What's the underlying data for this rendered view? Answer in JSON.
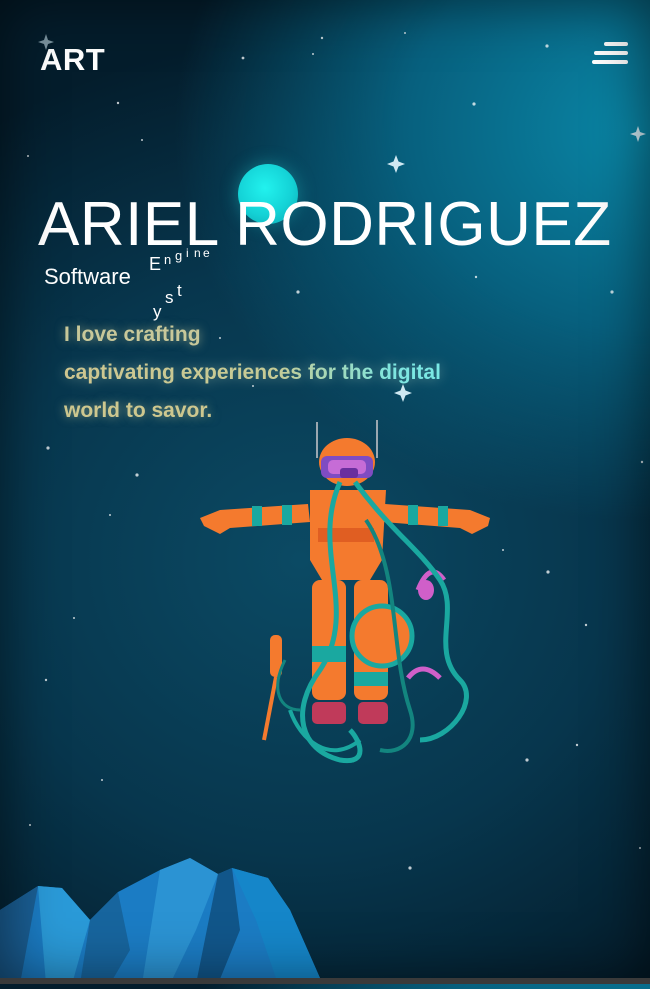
{
  "header": {
    "logo": "ART",
    "menu_icon": "hamburger-menu-icon"
  },
  "hero": {
    "name": "ARIEL RODRIGUEZ",
    "role_prefix": "Software",
    "role_animated_letters": [
      "E",
      "n",
      "g",
      "i",
      "n",
      "e",
      "y",
      "s",
      "t"
    ],
    "tagline_line1": "I love crafting",
    "tagline_line2": "captivating experiences for the digital",
    "tagline_line3": "world to savor."
  },
  "colors": {
    "background_dark": "#041d2c",
    "background_glow": "#0a86a6",
    "planet": "#14d2d6",
    "astronaut_suit": "#f47a2e",
    "astronaut_cables": "#1aa8a0",
    "mountains": "#1b7cc4"
  },
  "illustration": {
    "astronaut": "astronaut-icon",
    "planet": "planet-icon",
    "mountains": "mountains-icon"
  }
}
